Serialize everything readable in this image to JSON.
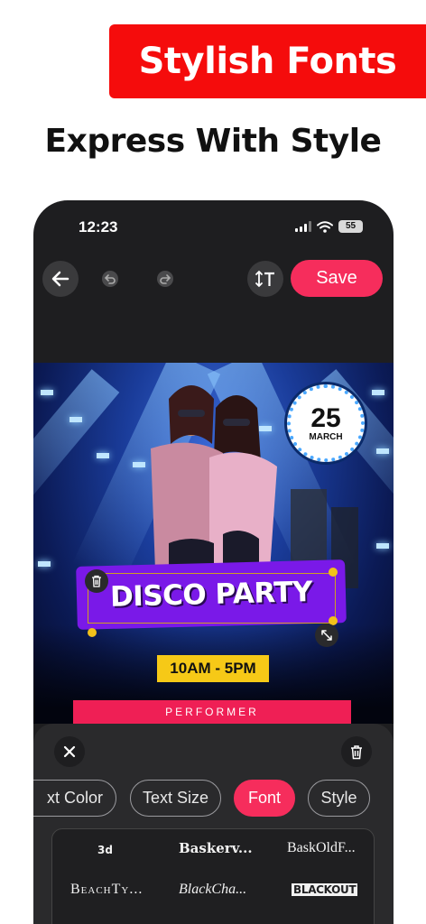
{
  "promo": {
    "banner_text": "Stylish Fonts",
    "subtitle": "Express With Style"
  },
  "status_bar": {
    "time": "12:23",
    "battery": "55"
  },
  "toolbar": {
    "save_label": "Save"
  },
  "poster": {
    "date_day": "25",
    "date_month": "MARCH",
    "title": "DISCO PARTY",
    "time_range": "10AM - 5PM",
    "performer": "PERFORMER"
  },
  "editor_tabs": [
    {
      "label": "xt Color",
      "active": false
    },
    {
      "label": "Text Size",
      "active": false
    },
    {
      "label": "Font",
      "active": true
    },
    {
      "label": "Style",
      "active": false
    }
  ],
  "fonts": [
    {
      "label": "3d"
    },
    {
      "label": "Baskerv..."
    },
    {
      "label": "BaskOldF..."
    },
    {
      "label": "BeachTy..."
    },
    {
      "label": "BlackCha..."
    },
    {
      "label": "BLACKOUT"
    }
  ],
  "colors": {
    "accent": "#f62d5c",
    "banner": "#f50c0c",
    "title_box": "#7a19e8",
    "time_tag": "#f6c917"
  }
}
